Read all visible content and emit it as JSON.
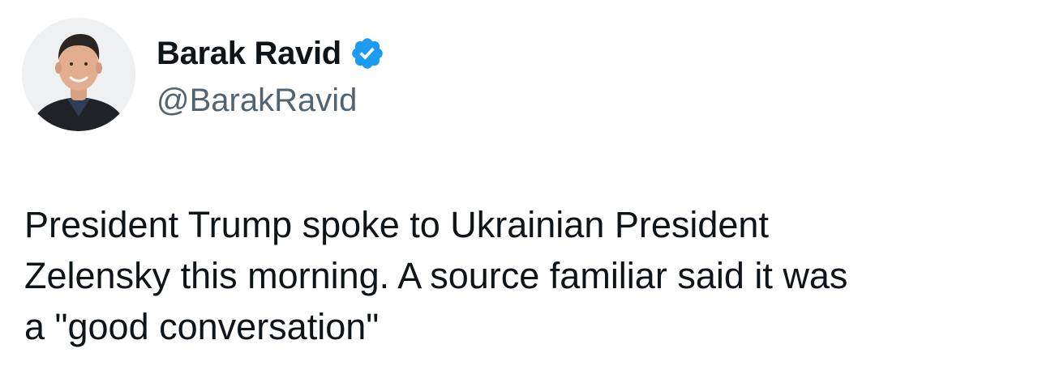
{
  "author": {
    "display_name": "Barak Ravid",
    "handle": "@BarakRavid",
    "verified": true,
    "avatar_icon": "profile-photo",
    "badge_icon": "verified-check-icon",
    "badge_color": "#1d9bf0"
  },
  "tweet": {
    "lines": [
      "President Trump spoke to Ukrainian President",
      "Zelensky this morning. A source familiar said it was",
      "a \"good conversation\""
    ]
  },
  "colors": {
    "text_primary": "#0f1419",
    "text_secondary": "#536471",
    "background": "#ffffff"
  }
}
